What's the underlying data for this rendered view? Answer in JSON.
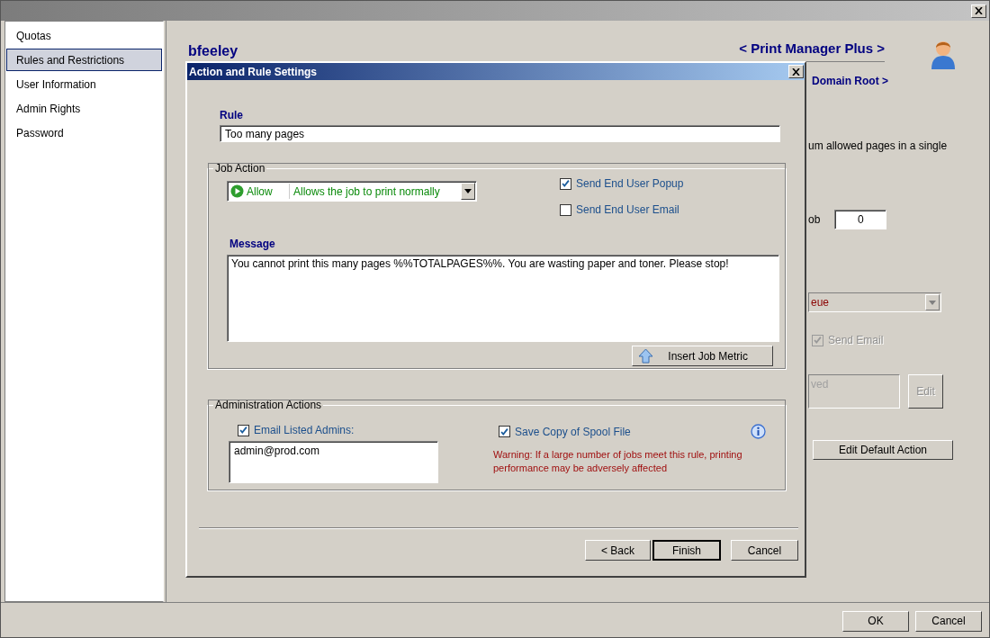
{
  "sidebar": {
    "items": [
      {
        "label": "Quotas",
        "selected": false
      },
      {
        "label": "Rules and Restrictions",
        "selected": true
      },
      {
        "label": "User Information",
        "selected": false
      },
      {
        "label": "Admin Rights",
        "selected": false
      },
      {
        "label": "Password",
        "selected": false
      }
    ]
  },
  "main": {
    "user_name": "bfeeley",
    "product_link": "< Print Manager Plus >",
    "breadcrumb": "Domain Root >",
    "description_fragment": "um allowed pages in a single",
    "limit_label_fragment": "ob",
    "limit_value": "0",
    "action_dropdown_fragment": "eue",
    "send_email": {
      "label": "Send Email",
      "checked": true,
      "disabled": true
    },
    "approval_field_fragment": "ved",
    "edit_button": {
      "label": "Edit",
      "disabled": true
    },
    "default_action_button": "Edit Default Action"
  },
  "dialog": {
    "title": "Action and Rule Settings",
    "rule_label": "Rule",
    "rule_value": "Too many pages",
    "job_action": {
      "legend": "Job Action",
      "action": {
        "name": "Allow",
        "description": "Allows the job to print normally"
      },
      "send_popup": {
        "label": "Send End User Popup",
        "checked": true
      },
      "send_email": {
        "label": "Send End User Email",
        "checked": false
      },
      "message_label": "Message",
      "message_value": "You cannot print this many pages %%TOTALPAGES%%. You are wasting paper and toner. Please stop!",
      "insert_button": "Insert Job Metric"
    },
    "admin_actions": {
      "legend": "Administration Actions",
      "email_admins": {
        "label": "Email Listed Admins:",
        "checked": true
      },
      "admins_list": "admin@prod.com",
      "save_spool": {
        "label": "Save Copy of Spool File",
        "checked": true
      },
      "warning": "Warning: If a large number of jobs meet this rule, printing performance may be adversely affected"
    },
    "buttons": [
      {
        "label": "< Back",
        "default": false
      },
      {
        "label": "Finish",
        "default": true
      },
      {
        "label": "Cancel",
        "default": false
      }
    ]
  },
  "footer": {
    "buttons": [
      "OK",
      "Cancel"
    ]
  }
}
